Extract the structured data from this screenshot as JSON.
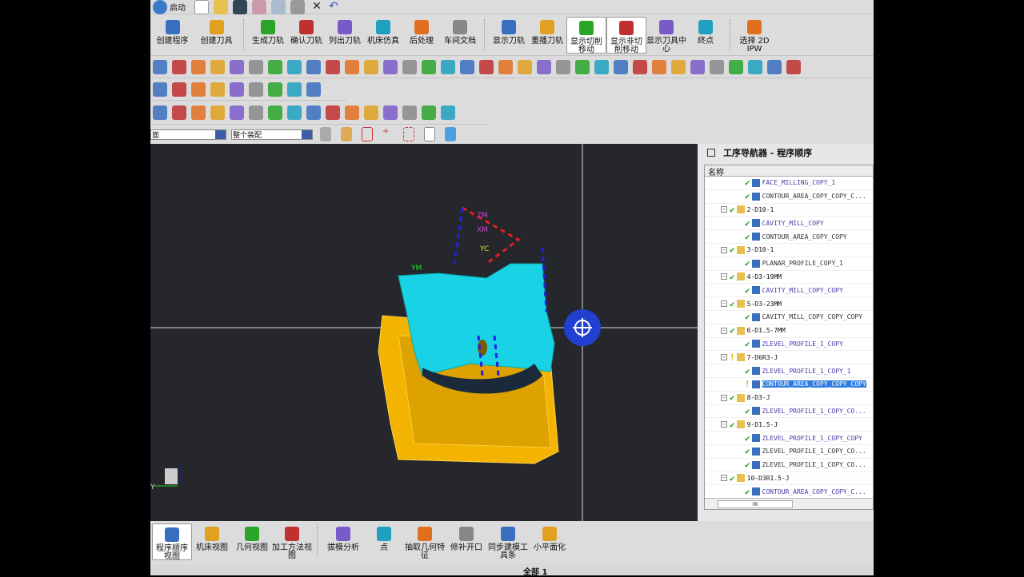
{
  "quickbar": {
    "start_label": "启动"
  },
  "toolbar_main": {
    "items": [
      {
        "label": "创建程序",
        "icon": "create-program-icon"
      },
      {
        "label": "创建刀具",
        "icon": "create-tool-icon"
      },
      {
        "label": "生成刀轨",
        "icon": "generate-toolpath-icon"
      },
      {
        "label": "确认刀轨",
        "icon": "verify-toolpath-icon"
      },
      {
        "label": "列出刀轨",
        "icon": "list-toolpath-icon"
      },
      {
        "label": "机床仿真",
        "icon": "machine-simulation-icon"
      },
      {
        "label": "后处理",
        "icon": "postprocess-icon"
      },
      {
        "label": "车间文档",
        "icon": "shop-doc-icon"
      },
      {
        "label": "显示刀轨",
        "icon": "display-toolpath-icon"
      },
      {
        "label": "重播刀轨",
        "icon": "replay-toolpath-icon"
      },
      {
        "label": "显示切削移动",
        "icon": "show-cut-move-icon",
        "selected": true
      },
      {
        "label": "显示非切削移动",
        "icon": "show-noncut-move-icon",
        "selected": true
      },
      {
        "label": "显示刀具中心",
        "icon": "show-tool-center-icon"
      },
      {
        "label": "终点",
        "icon": "endpoint-icon"
      },
      {
        "label": "选择 2D IPW",
        "icon": "select-2d-ipw-icon"
      }
    ]
  },
  "filters": {
    "type_filter": "面",
    "scope_filter": "整个装配"
  },
  "viewport": {
    "labels": {
      "zm": "ZM",
      "xm": "XM",
      "yc": "YC",
      "ym": "YM",
      "triad_y": "Y"
    },
    "colors": {
      "part": "#19d2e6",
      "blank": "#f2b400",
      "background": "#25272c"
    }
  },
  "navigator": {
    "title": "工序导航器 - 程序顺序",
    "column_header": "名称",
    "rows": [
      {
        "level": 2,
        "status": "ok",
        "label": "FACE_MILLING_COPY_1",
        "color": "blue"
      },
      {
        "level": 2,
        "status": "ok",
        "label": "CONTOUR_AREA_COPY_COPY_C...",
        "color": "black"
      },
      {
        "level": 1,
        "status": "ok",
        "label": "2-D10-1"
      },
      {
        "level": 2,
        "status": "ok",
        "label": "CAVITY_MILL_COPY",
        "color": "blue"
      },
      {
        "level": 2,
        "status": "ok",
        "label": "CONTOUR_AREA_COPY_COPY",
        "color": "black"
      },
      {
        "level": 1,
        "status": "ok",
        "label": "3-D10-1"
      },
      {
        "level": 2,
        "status": "ok",
        "label": "PLANAR_PROFILE_COPY_1",
        "color": "black"
      },
      {
        "level": 1,
        "status": "ok",
        "label": "4-D3-19MM"
      },
      {
        "level": 2,
        "status": "ok",
        "label": "CAVITY_MILL_COPY_COPY",
        "color": "blue"
      },
      {
        "level": 1,
        "status": "ok",
        "label": "5-D3-23MM"
      },
      {
        "level": 2,
        "status": "ok",
        "label": "CAVITY_MILL_COPY_COPY_COPY",
        "color": "black"
      },
      {
        "level": 1,
        "status": "ok",
        "label": "6-D1.5-7MM"
      },
      {
        "level": 2,
        "status": "ok",
        "label": "ZLEVEL_PROFILE_1_COPY",
        "color": "blue"
      },
      {
        "level": 1,
        "status": "warn",
        "label": "7-D6R3-J"
      },
      {
        "level": 2,
        "status": "ok",
        "label": "ZLEVEL_PROFILE_1_COPY_1",
        "color": "blue"
      },
      {
        "level": 2,
        "status": "warn",
        "label": "CONTOUR_AREA_COPY_COPY_COPY",
        "color": "black",
        "selected": true
      },
      {
        "level": 1,
        "status": "ok",
        "label": "8-D3-J"
      },
      {
        "level": 2,
        "status": "ok",
        "label": "ZLEVEL_PROFILE_1_COPY_CO...",
        "color": "blue"
      },
      {
        "level": 1,
        "status": "ok",
        "label": "9-D1.5-J"
      },
      {
        "level": 2,
        "status": "ok",
        "label": "ZLEVEL_PROFILE_1_COPY_COPY",
        "color": "blue"
      },
      {
        "level": 2,
        "status": "ok",
        "label": "ZLEVEL_PROFILE_1_COPY_CO...",
        "color": "black"
      },
      {
        "level": 2,
        "status": "ok",
        "label": "ZLEVEL_PROFILE_1_COPY_CO...",
        "color": "black"
      },
      {
        "level": 1,
        "status": "ok",
        "label": "10-D3R1.5-J"
      },
      {
        "level": 2,
        "status": "ok",
        "label": "CONTOUR_AREA_COPY_COPY_C...",
        "color": "blue"
      }
    ],
    "scroll_label": "III"
  },
  "bottom_toolbar": {
    "items": [
      {
        "label": "程序顺序视图",
        "icon": "program-order-view-icon",
        "selected": true
      },
      {
        "label": "机床视图",
        "icon": "machine-view-icon"
      },
      {
        "label": "几何视图",
        "icon": "geometry-view-icon"
      },
      {
        "label": "加工方法视图",
        "icon": "method-view-icon"
      },
      {
        "label": "拔模分析",
        "icon": "draft-analysis-icon"
      },
      {
        "label": "点",
        "icon": "point-icon"
      },
      {
        "label": "抽取几何特征",
        "icon": "extract-geometry-icon"
      },
      {
        "label": "修补开口",
        "icon": "patch-opening-icon"
      },
      {
        "label": "同步建模工具条",
        "icon": "sync-modeling-icon"
      },
      {
        "label": "小平面化",
        "icon": "facet-icon"
      }
    ]
  },
  "status": {
    "text": "全部 1"
  }
}
